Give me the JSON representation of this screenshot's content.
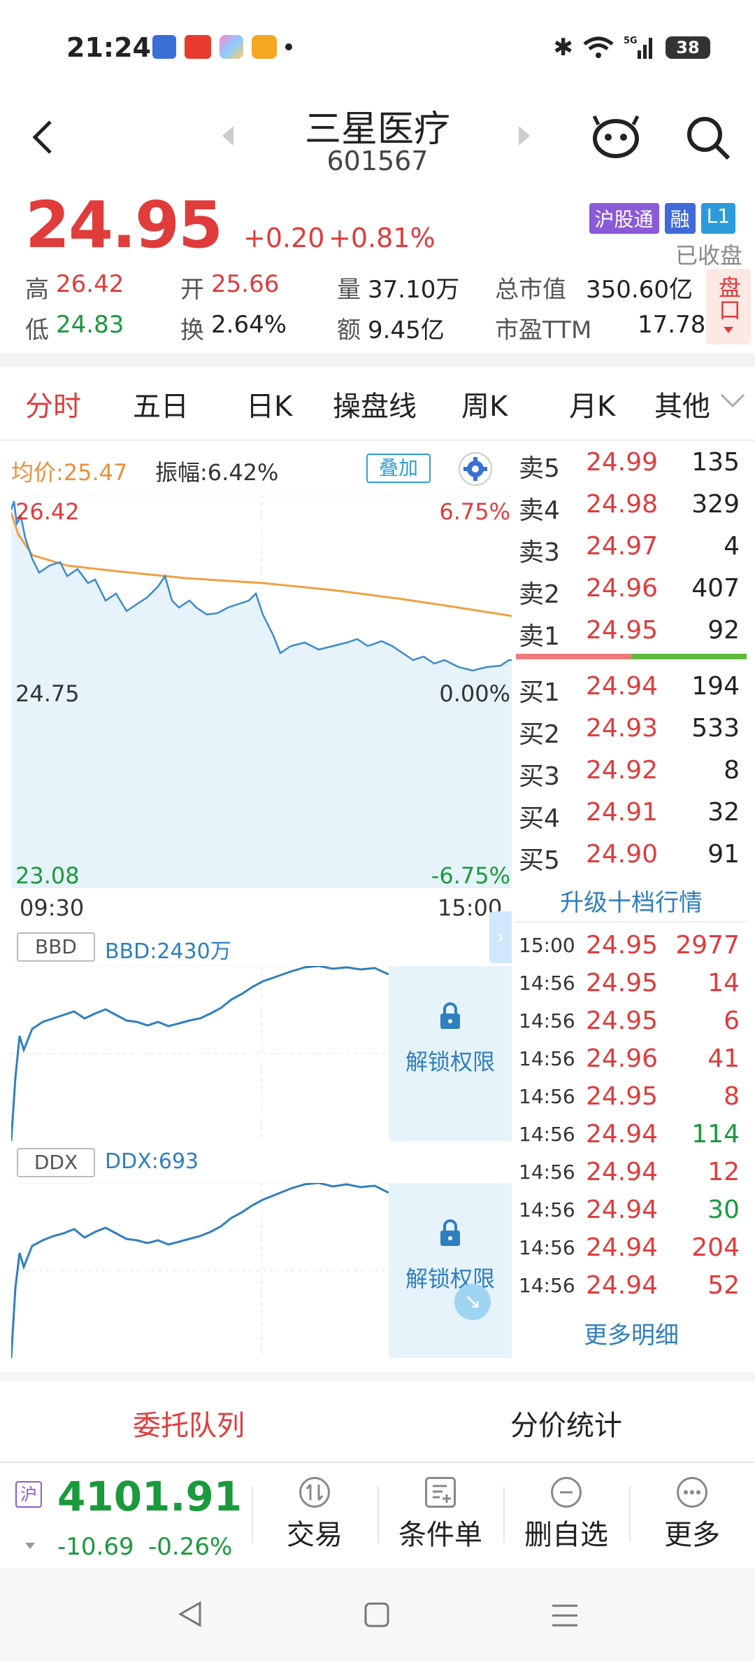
{
  "status_bar": {
    "time": "21:24",
    "battery": "38",
    "signal": "5G"
  },
  "header": {
    "title": "三星医疗",
    "code": "601567"
  },
  "quote": {
    "price": "24.95",
    "change": "+0.20",
    "change_pct": "+0.81%",
    "badges": [
      "沪股通",
      "融",
      "L1"
    ],
    "status": "已收盘",
    "high_label": "高",
    "high": "26.42",
    "open_label": "开",
    "open": "25.66",
    "volume_label": "量",
    "volume": "37.10万",
    "mktcap_label": "总市值",
    "mktcap": "350.60亿",
    "low_label": "低",
    "low": "24.83",
    "turnover_label": "换",
    "turnover": "2.64%",
    "amount_label": "额",
    "amount": "9.45亿",
    "pe_label": "市盈TTM",
    "pe": "17.78",
    "side_button": "盘口"
  },
  "tabs": [
    "分时",
    "五日",
    "日K",
    "操盘线",
    "周K",
    "月K",
    "其他"
  ],
  "intraday": {
    "avg_label": "均价:25.47",
    "amp_label": "振幅:6.42%",
    "overlay_btn": "叠加",
    "y_top": "26.42",
    "y_mid": "24.75",
    "y_bot": "23.08",
    "pct_top": "6.75%",
    "pct_mid": "0.00%",
    "pct_bot": "-6.75%",
    "t_start": "09:30",
    "t_end": "15:00"
  },
  "bbd": {
    "tag": "BBD",
    "value": "BBD:2430万",
    "unlock": "解锁权限"
  },
  "ddx": {
    "tag": "DDX",
    "value": "DDX:693",
    "unlock": "解锁权限"
  },
  "orderbook": {
    "asks": [
      {
        "label": "卖5",
        "price": "24.99",
        "vol": "135"
      },
      {
        "label": "卖4",
        "price": "24.98",
        "vol": "329"
      },
      {
        "label": "卖3",
        "price": "24.97",
        "vol": "4"
      },
      {
        "label": "卖2",
        "price": "24.96",
        "vol": "407"
      },
      {
        "label": "卖1",
        "price": "24.95",
        "vol": "92"
      }
    ],
    "bids": [
      {
        "label": "买1",
        "price": "24.94",
        "vol": "194"
      },
      {
        "label": "买2",
        "price": "24.93",
        "vol": "533"
      },
      {
        "label": "买3",
        "price": "24.92",
        "vol": "8"
      },
      {
        "label": "买4",
        "price": "24.91",
        "vol": "32"
      },
      {
        "label": "买5",
        "price": "24.90",
        "vol": "91"
      }
    ],
    "upgrade": "升级十档行情"
  },
  "trades": [
    {
      "time": "15:00",
      "price": "24.95",
      "vol": "2977",
      "color": "red"
    },
    {
      "time": "14:56",
      "price": "24.95",
      "vol": "14",
      "color": "red"
    },
    {
      "time": "14:56",
      "price": "24.95",
      "vol": "6",
      "color": "red"
    },
    {
      "time": "14:56",
      "price": "24.96",
      "vol": "41",
      "color": "red"
    },
    {
      "time": "14:56",
      "price": "24.95",
      "vol": "8",
      "color": "red"
    },
    {
      "time": "14:56",
      "price": "24.94",
      "vol": "114",
      "color": "green"
    },
    {
      "time": "14:56",
      "price": "24.94",
      "vol": "12",
      "color": "red"
    },
    {
      "time": "14:56",
      "price": "24.94",
      "vol": "30",
      "color": "green"
    },
    {
      "time": "14:56",
      "price": "24.94",
      "vol": "204",
      "color": "red"
    },
    {
      "time": "14:56",
      "price": "24.94",
      "vol": "52",
      "color": "red"
    }
  ],
  "more_detail": "更多明细",
  "bottom_tabs": [
    "委托队列",
    "分价统计"
  ],
  "index": {
    "tag": "沪",
    "value": "4101.91",
    "change": "-10.69",
    "change_pct": "-0.26%"
  },
  "actions": [
    "交易",
    "条件单",
    "删自选",
    "更多"
  ]
}
